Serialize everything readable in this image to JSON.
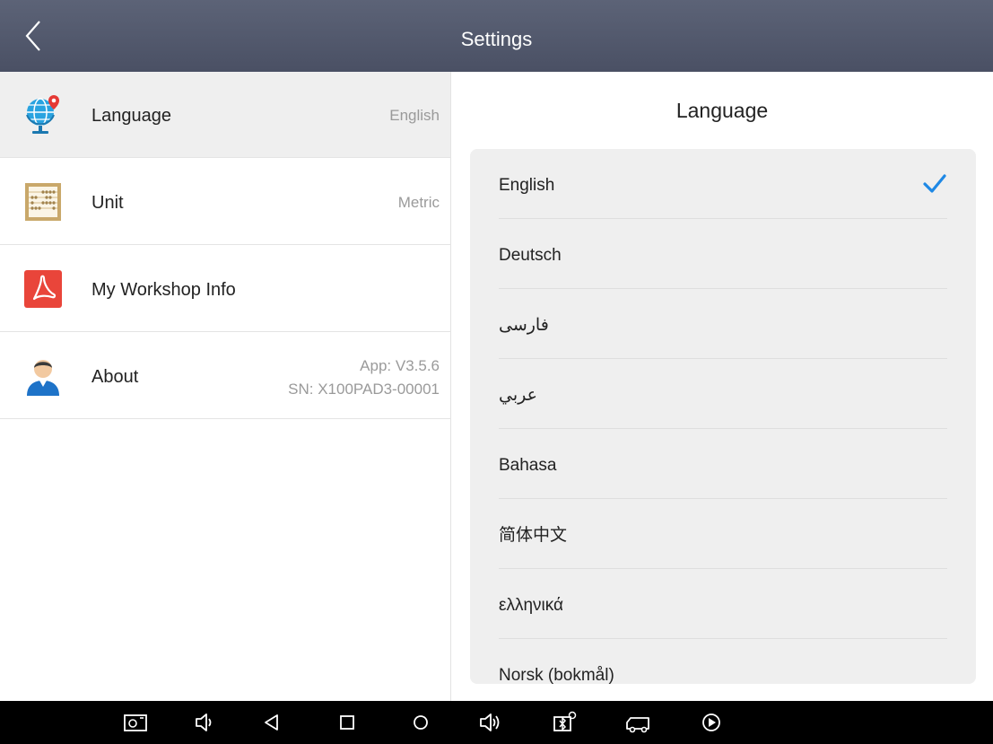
{
  "header": {
    "title": "Settings"
  },
  "sidebar": {
    "items": [
      {
        "label": "Language",
        "value": "English"
      },
      {
        "label": "Unit",
        "value": "Metric"
      },
      {
        "label": "My Workshop Info",
        "value": ""
      },
      {
        "label": "About",
        "value": "App: V3.5.6",
        "value2": "SN: X100PAD3-00001"
      }
    ]
  },
  "panel": {
    "title": "Language",
    "languages": [
      {
        "label": "English",
        "selected": true
      },
      {
        "label": "Deutsch",
        "selected": false
      },
      {
        "label": "فارسی",
        "selected": false
      },
      {
        "label": "عربي",
        "selected": false
      },
      {
        "label": "Bahasa",
        "selected": false
      },
      {
        "label": "简体中文",
        "selected": false
      },
      {
        "label": "ελληνικά",
        "selected": false
      },
      {
        "label": "Norsk (bokmål)",
        "selected": false
      }
    ]
  },
  "colors": {
    "header": "#51576b",
    "accent": "#1e88e5",
    "selected_row": "#efefef"
  },
  "navbar": {
    "icons": [
      "screenshot-icon",
      "volume-down-icon",
      "back-icon",
      "recent-apps-icon",
      "home-icon",
      "volume-up-icon",
      "bluetooth-vci-icon",
      "truck-icon",
      "play-icon"
    ]
  }
}
